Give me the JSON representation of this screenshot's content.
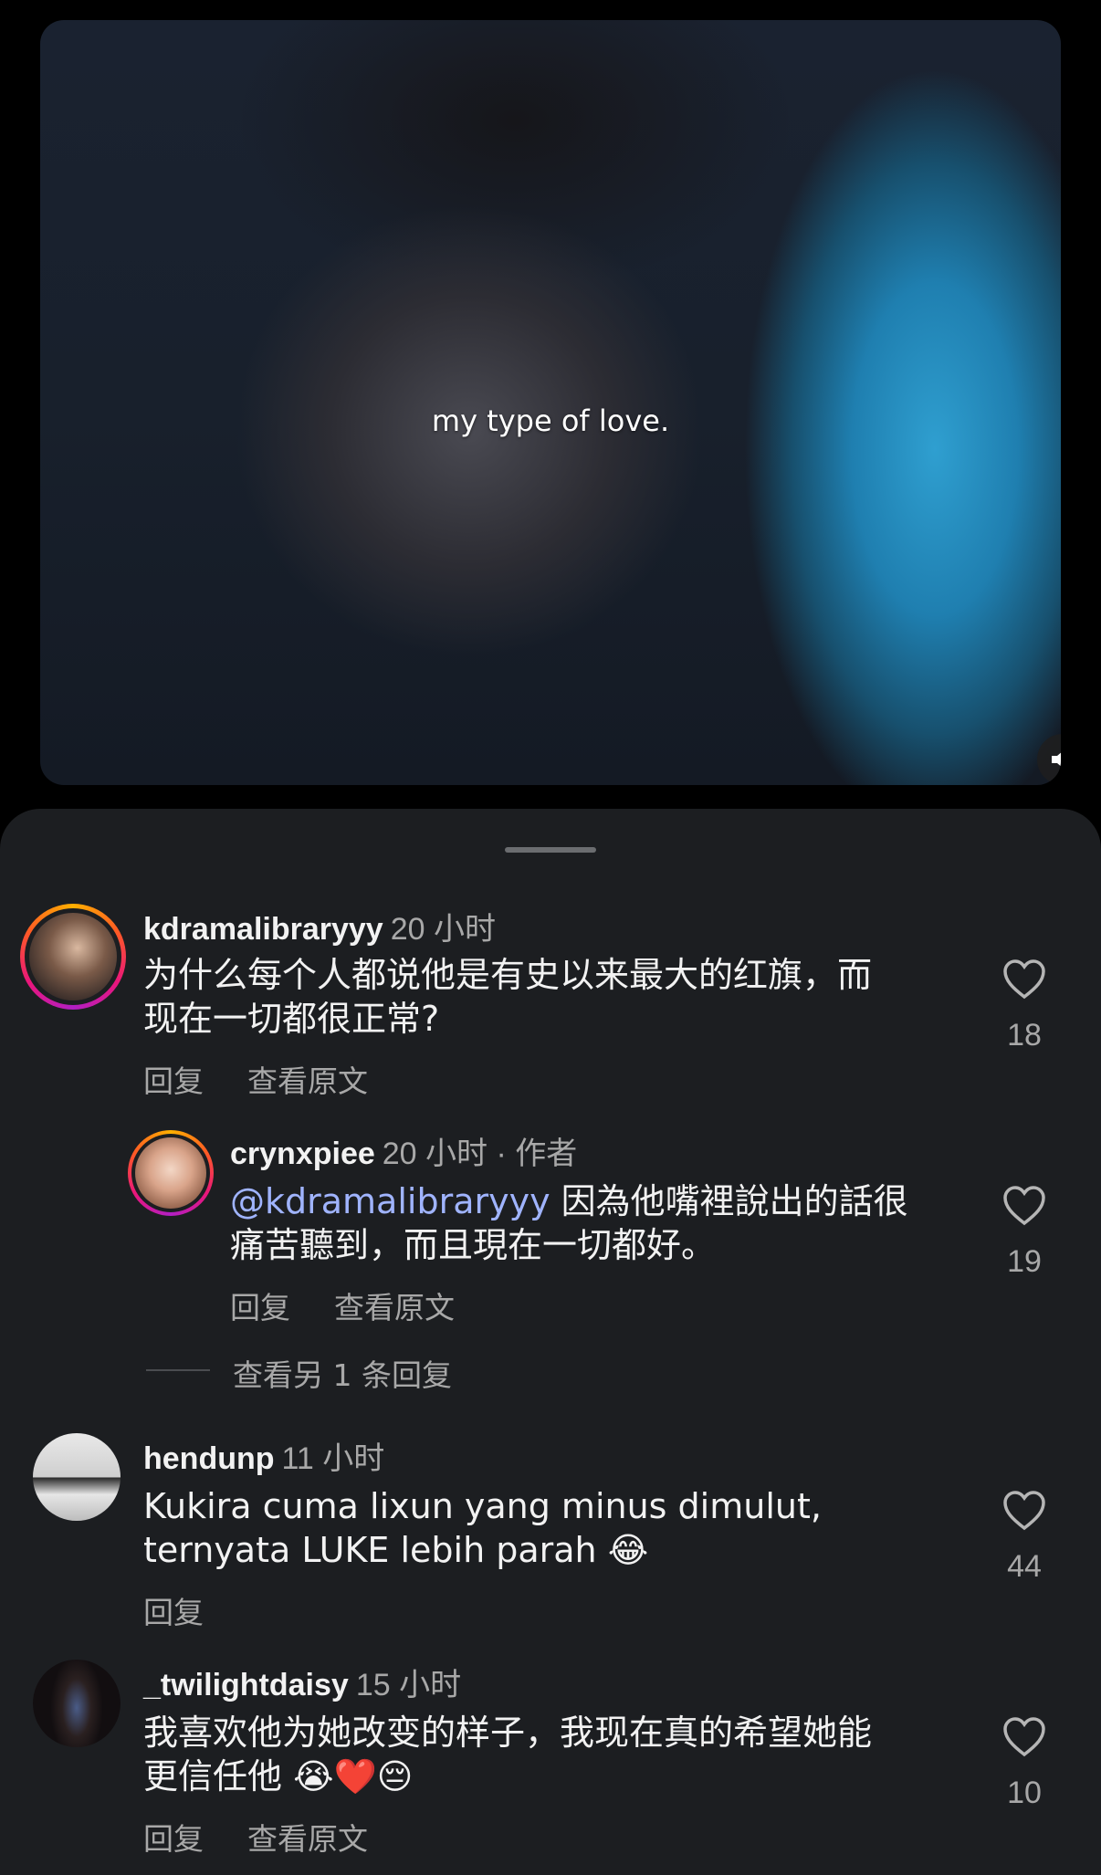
{
  "video": {
    "caption": "my type of love."
  },
  "comments": [
    {
      "username": "kdramalibraryyy",
      "time": "20 小时",
      "line1": "为什么每个人都说他是有史以来最大的红旗，而",
      "line2": "现在一切都很正常?",
      "actions": [
        "回复",
        "查看原文"
      ],
      "likes": "18"
    },
    {
      "username": "crynxpiee",
      "time": "20 小时",
      "dot": " · ",
      "badge": "作者",
      "mention": "@kdramalibraryyy",
      "line1_rest": " 因為他嘴裡說出的話很",
      "line2": "痛苦聽到，而且現在一切都好。",
      "actions": [
        "回复",
        "查看原文"
      ],
      "likes": "19"
    },
    {
      "username": "hendunp",
      "time": "11 小时",
      "line1": "Kukira cuma lixun yang minus dimulut,",
      "line2": "ternyata LUKE lebih parah 😂",
      "actions": [
        "回复"
      ],
      "likes": "44"
    },
    {
      "username": "_twilightdaisy",
      "time": "15 小时",
      "line1": "我喜欢他为她改变的样子，我现在真的希望她能",
      "line2": "更信任他 😭❤️😔",
      "actions": [
        "回复",
        "查看原文"
      ],
      "likes": "10"
    }
  ],
  "more_replies": "查看另 1 条回复",
  "icons": {
    "volume": "volume-icon",
    "like": "heart-outline-icon"
  },
  "colors": {
    "sheet_bg": "#1c1e21",
    "mention": "#a0b4ff",
    "secondary_text": "#a8a8a8"
  }
}
